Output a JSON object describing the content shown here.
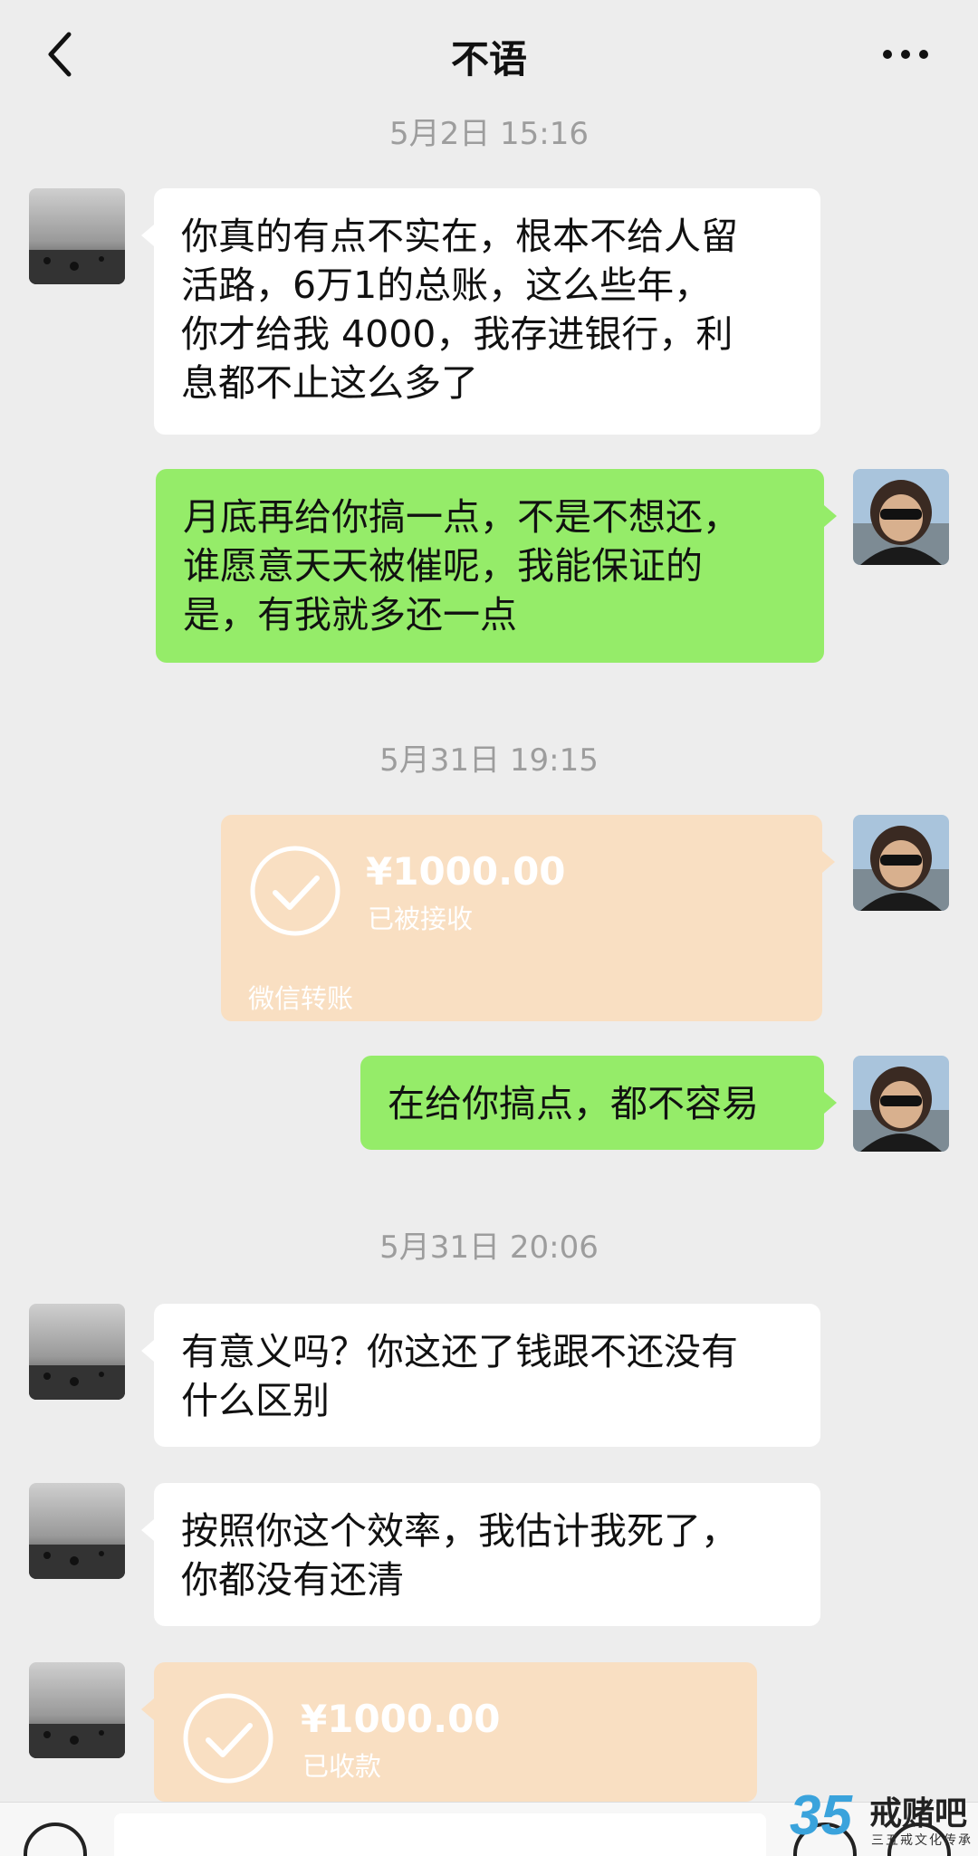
{
  "header": {
    "title": "不语"
  },
  "timestamps": [
    "5月2日 15:16",
    "5月31日 19:15",
    "5月31日 20:06"
  ],
  "messages": [
    {
      "side": "left",
      "lines": [
        "你真的有点不实在，根本不给人留",
        "活路，6万1的总账，这么些年，",
        "你才给我 4000，我存进银行，利",
        "息都不止这么多了"
      ]
    },
    {
      "side": "right",
      "lines": [
        "月底再给你搞一点，不是不想还，",
        "谁愿意天天被催呢，我能保证的",
        "是，有我就多还一点"
      ]
    },
    {
      "side": "right",
      "type": "transfer",
      "amount": "¥1000.00",
      "status": "已被接收",
      "footer": "微信转账"
    },
    {
      "side": "right",
      "lines": [
        "在给你搞点，都不容易"
      ]
    },
    {
      "side": "left",
      "lines": [
        "有意义吗？你这还了钱跟不还没有",
        "什么区别"
      ]
    },
    {
      "side": "left",
      "lines": [
        "按照你这个效率，我估计我死了，",
        "你都没有还清"
      ]
    },
    {
      "side": "left",
      "type": "transfer",
      "amount": "¥1000.00",
      "status": "已收款"
    }
  ],
  "watermark": {
    "number": "35",
    "name": "戒赌吧",
    "subtitle": "三五戒文化传承"
  },
  "colors": {
    "background": "#ededed",
    "outgoing_bubble": "#95ec69",
    "incoming_bubble": "#ffffff",
    "transfer_card": "#f9dfc2"
  },
  "icons": [
    "back-chevron-icon",
    "more-dots-icon",
    "check-circle-icon",
    "voice-icon",
    "emoji-icon",
    "plus-icon"
  ]
}
